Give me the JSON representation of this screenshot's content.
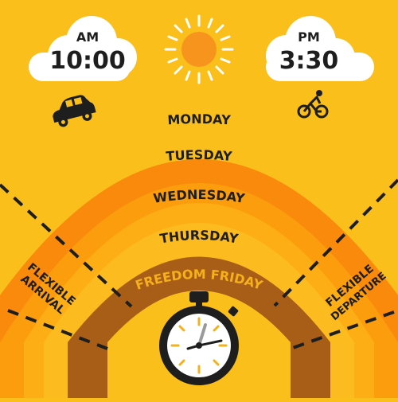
{
  "colors": {
    "background": "#fbbf1c",
    "band_monday": "#f98a0b",
    "band_tuesday": "#fb9d0d",
    "band_wednesday": "#fcae14",
    "band_thursday": "#fcbb1f",
    "band_friday": "#a85e17",
    "text_dark": "#1e1e1e",
    "text_friday": "#f5b01a",
    "cloud": "#ffffff",
    "sun": "#f7941d",
    "clock_face": "#ffffff",
    "clock_accent": "#f5b01a"
  },
  "arrival": {
    "period": "AM",
    "time": "10:00",
    "icon": "car-icon"
  },
  "departure": {
    "period": "PM",
    "time": "3:30",
    "icon": "cyclist-icon"
  },
  "sun_icon": "sun-icon",
  "days": [
    {
      "label": "MONDAY"
    },
    {
      "label": "TUESDAY"
    },
    {
      "label": "WEDNESDAY"
    },
    {
      "label": "THURSDAY"
    },
    {
      "label": "FREEDOM FRIDAY"
    }
  ],
  "flexible_arrival": {
    "line1": "FLEXIBLE",
    "line2": "ARRIVAL"
  },
  "flexible_departure": {
    "line1": "FLEXIBLE",
    "line2": "DEPARTURE"
  },
  "clock_icon": "stopwatch-icon"
}
